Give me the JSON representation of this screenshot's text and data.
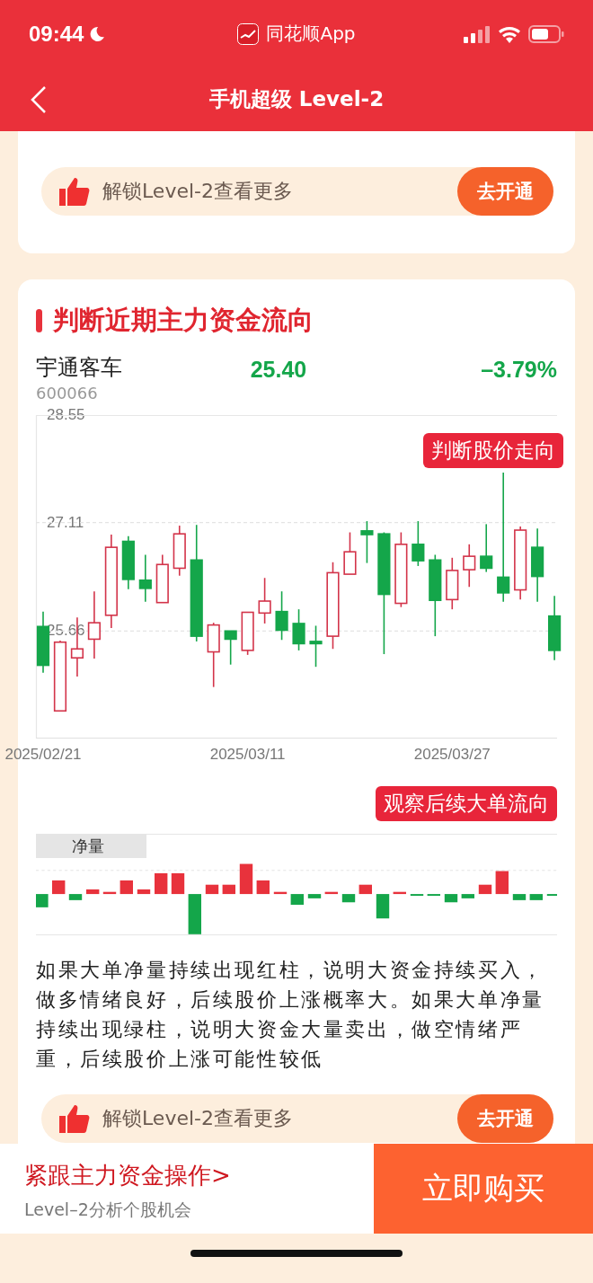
{
  "status_bar": {
    "time": "09:44",
    "app_name": "同花顺App"
  },
  "header": {
    "title": "手机超级 Level-2"
  },
  "promo_top": {
    "text": "解锁Level-2查看更多",
    "button": "去开通"
  },
  "section": {
    "title": "判断近期主力资金流向"
  },
  "stock": {
    "name": "宇通客车",
    "code": "600066",
    "price": "25.40",
    "change": "–3.79%"
  },
  "price_chart": {
    "callout": "判断股价走向",
    "chart_data": {
      "type": "candlestick",
      "categories": [
        "2025/02/21",
        null,
        null,
        null,
        null,
        null,
        null,
        null,
        null,
        null,
        null,
        null,
        "2025/03/11",
        null,
        null,
        null,
        null,
        null,
        null,
        null,
        null,
        null,
        null,
        null,
        "2025/03/27",
        null,
        null,
        null,
        null,
        null,
        null
      ],
      "ohlc": [
        [
          25.72,
          25.92,
          25.1,
          25.2
        ],
        [
          24.59,
          25.53,
          24.59,
          25.51
        ],
        [
          25.3,
          25.84,
          25.05,
          25.42
        ],
        [
          25.55,
          26.19,
          25.29,
          25.77
        ],
        [
          25.87,
          26.95,
          25.7,
          26.78
        ],
        [
          26.86,
          26.93,
          26.22,
          26.35
        ],
        [
          26.34,
          26.68,
          26.05,
          26.23
        ],
        [
          26.04,
          26.68,
          26.04,
          26.55
        ],
        [
          26.5,
          27.07,
          26.4,
          26.96
        ],
        [
          26.61,
          27.08,
          25.52,
          25.59
        ],
        [
          25.38,
          25.77,
          24.91,
          25.74
        ],
        [
          25.66,
          25.66,
          25.21,
          25.55
        ],
        [
          25.4,
          25.91,
          25.34,
          25.91
        ],
        [
          25.9,
          26.37,
          25.76,
          26.06
        ],
        [
          25.92,
          26.19,
          25.54,
          25.67
        ],
        [
          25.76,
          25.95,
          25.4,
          25.49
        ],
        [
          25.52,
          25.73,
          25.18,
          25.49
        ],
        [
          25.59,
          26.58,
          25.42,
          26.44
        ],
        [
          26.42,
          26.98,
          26.42,
          26.72
        ],
        [
          27.0,
          27.13,
          26.57,
          26.95
        ],
        [
          26.96,
          26.98,
          25.35,
          26.15
        ],
        [
          26.03,
          26.98,
          25.98,
          26.82
        ],
        [
          26.82,
          27.13,
          26.53,
          26.6
        ],
        [
          26.61,
          26.68,
          25.59,
          26.07
        ],
        [
          26.08,
          26.64,
          25.95,
          26.47
        ],
        [
          26.48,
          26.82,
          26.25,
          26.66
        ],
        [
          26.66,
          27.09,
          26.45,
          26.5
        ],
        [
          26.38,
          27.78,
          26.05,
          26.17
        ],
        [
          26.21,
          27.06,
          26.08,
          27.01
        ],
        [
          26.78,
          27.03,
          26.05,
          26.39
        ],
        [
          25.86,
          26.13,
          25.27,
          25.4
        ]
      ],
      "ylim": [
        24.22,
        28.55
      ],
      "yticks": [
        28.55,
        27.11,
        25.66
      ]
    }
  },
  "flow_chart": {
    "callout": "观察后续大单流向",
    "label": "净量"
  },
  "description": "如果大单净量持续出现红柱，说明大资金持续买入，做多情绪良好，后续股价上涨概率大。如果大单净量持续出现绿柱，说明大资金大量卖出，做空情绪严重，后续股价上涨可能性较低",
  "promo_bottom": {
    "text": "解锁Level-2查看更多",
    "button": "去开通"
  },
  "bottom_bar": {
    "title": "紧跟主力资金操作>",
    "subtitle": "Level–2分析个股机会",
    "buy_button": "立即购买"
  }
}
